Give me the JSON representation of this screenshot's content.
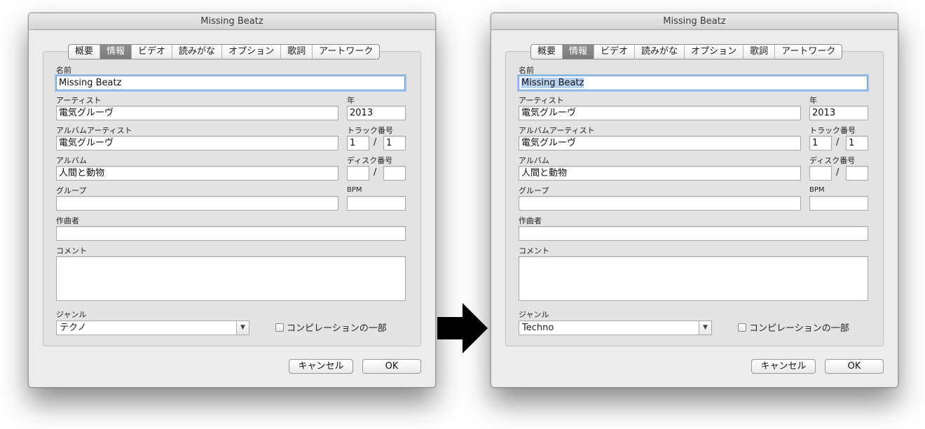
{
  "left": {
    "title": "Missing Beatz",
    "tabs": [
      "概要",
      "情報",
      "ビデオ",
      "読みがな",
      "オプション",
      "歌詞",
      "アートワーク"
    ],
    "active_tab": 1,
    "labels": {
      "name": "名前",
      "artist": "アーティスト",
      "year": "年",
      "album_artist": "アルバムアーティスト",
      "track_number": "トラック番号",
      "album": "アルバム",
      "disc_number": "ディスク番号",
      "grouping": "グループ",
      "bpm": "BPM",
      "composer": "作曲者",
      "comments": "コメント",
      "genre": "ジャンル"
    },
    "values": {
      "name": "Missing Beatz",
      "artist": "電気グルーヴ",
      "year": "2013",
      "album_artist": "電気グルーヴ",
      "track": "1",
      "track_total": "1",
      "album": "人間と動物",
      "disc": "",
      "disc_total": "",
      "grouping": "",
      "bpm": "",
      "composer": "",
      "comments": "",
      "genre": "テクノ"
    },
    "slash": "/",
    "compilation_label": "コンピレーションの一部",
    "cancel_label": "キャンセル",
    "ok_label": "OK"
  },
  "right": {
    "title": "Missing Beatz",
    "tabs": [
      "概要",
      "情報",
      "ビデオ",
      "読みがな",
      "オプション",
      "歌詞",
      "アートワーク"
    ],
    "active_tab": 1,
    "labels": {
      "name": "名前",
      "artist": "アーティスト",
      "year": "年",
      "album_artist": "アルバムアーティスト",
      "track_number": "トラック番号",
      "album": "アルバム",
      "disc_number": "ディスク番号",
      "grouping": "グループ",
      "bpm": "BPM",
      "composer": "作曲者",
      "comments": "コメント",
      "genre": "ジャンル"
    },
    "values": {
      "name": "Missing Beatz",
      "artist": "電気グルーヴ",
      "year": "2013",
      "album_artist": "電気グルーヴ",
      "track": "1",
      "track_total": "1",
      "album": "人間と動物",
      "disc": "",
      "disc_total": "",
      "grouping": "",
      "bpm": "",
      "composer": "",
      "comments": "",
      "genre": "Techno"
    },
    "slash": "/",
    "compilation_label": "コンピレーションの一部",
    "cancel_label": "キャンセル",
    "ok_label": "OK"
  },
  "icons": {
    "combo_arrow": "chevron-down-icon",
    "transition_arrow": "right-arrow-icon"
  },
  "colors": {
    "active_tab": "#858585",
    "focus_ring": "#9fc2ea",
    "selection": "#b7d1f1",
    "window_bg": "#ececec"
  }
}
